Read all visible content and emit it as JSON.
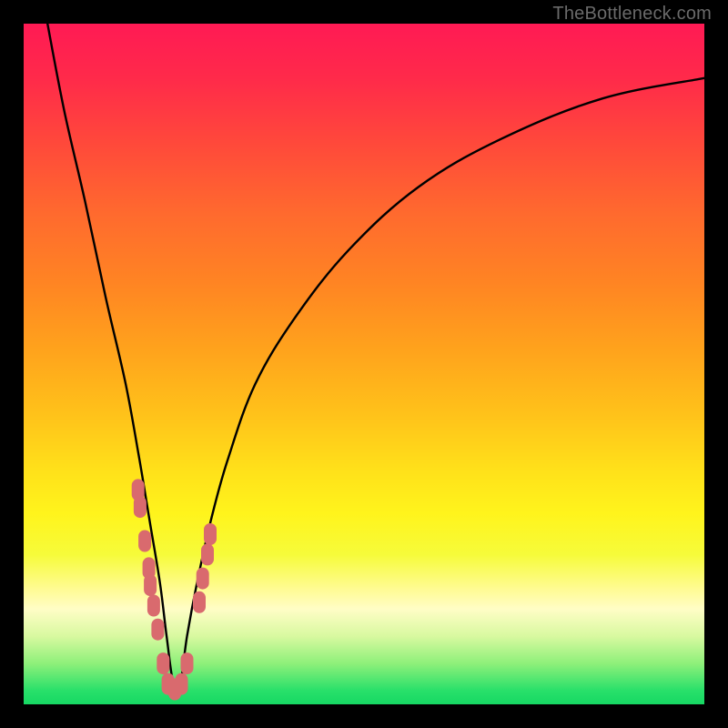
{
  "watermark": "TheBottleneck.com",
  "colors": {
    "frame": "#000000",
    "curve": "#000000",
    "marker_fill": "#d96a6e",
    "marker_stroke": "#c95054",
    "gradient_top": "#ff1a54",
    "gradient_bottom": "#16d863"
  },
  "chart_data": {
    "type": "line",
    "title": "",
    "xlabel": "",
    "ylabel": "",
    "x_range": [
      0,
      100
    ],
    "y_range": [
      0,
      100
    ],
    "note": "y≈0 at bottom (green, no bottleneck), y≈100 at top (red, full bottleneck). Curve is a V with minimum near x≈22.",
    "series": [
      {
        "name": "bottleneck-curve",
        "x": [
          3.5,
          6,
          9,
          12,
          15,
          17,
          18.5,
          20,
          21,
          22,
          23,
          24,
          25.5,
          27.5,
          30,
          34,
          40,
          48,
          58,
          70,
          85,
          100
        ],
        "values": [
          100,
          87,
          74,
          60,
          47,
          36,
          27,
          18,
          10,
          3,
          3,
          10,
          18,
          27,
          36,
          47,
          57,
          67,
          76,
          83,
          89,
          92
        ]
      }
    ],
    "markers": {
      "name": "highlighted-points",
      "note": "salmon capsule markers clustered near the minimum of the V",
      "points": [
        {
          "x": 16.8,
          "y": 31.5
        },
        {
          "x": 17.1,
          "y": 29.0
        },
        {
          "x": 17.8,
          "y": 24.0
        },
        {
          "x": 18.4,
          "y": 20.0
        },
        {
          "x": 18.6,
          "y": 17.5
        },
        {
          "x": 19.1,
          "y": 14.5
        },
        {
          "x": 19.7,
          "y": 11.0
        },
        {
          "x": 20.5,
          "y": 6.0
        },
        {
          "x": 21.2,
          "y": 3.0
        },
        {
          "x": 22.2,
          "y": 2.2
        },
        {
          "x": 23.2,
          "y": 3.0
        },
        {
          "x": 24.0,
          "y": 6.0
        },
        {
          "x": 25.8,
          "y": 15.0
        },
        {
          "x": 26.3,
          "y": 18.5
        },
        {
          "x": 27.0,
          "y": 22.0
        },
        {
          "x": 27.4,
          "y": 25.0
        }
      ]
    }
  }
}
